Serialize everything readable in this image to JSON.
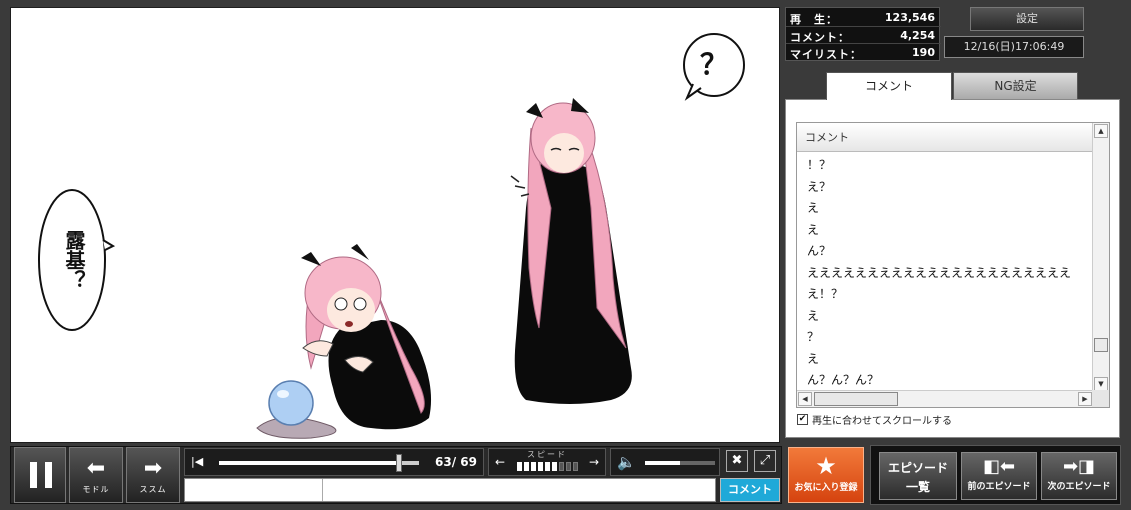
{
  "stats": {
    "play_label": "再　生：",
    "play_value": "123,546",
    "comment_label": "コメント：",
    "comment_value": "4,254",
    "mylist_label": "マイリスト：",
    "mylist_value": "190"
  },
  "settings_label": "設定",
  "datetime": "12/16(日)17:06:49",
  "tabs": {
    "comment": "コメント",
    "ng": "NG設定"
  },
  "comment_list": {
    "header": "コメント",
    "rows": [
      "！？",
      "え？",
      "え",
      "え",
      "ん？",
      "ええええええええええええええええええええええ",
      "え！？",
      "え",
      "？",
      "え",
      "ん？ん？ん？"
    ]
  },
  "autoscroll": {
    "checked": "✔",
    "label": "再生に合わせてスクロールする"
  },
  "video": {
    "bubble_right": "？",
    "bubble_left": "露基？"
  },
  "controls": {
    "back_label": "モドル",
    "forward_label": "ススム",
    "time": "63/ 69",
    "speed_label": "スピード",
    "seek_progress": 0.9,
    "volume_level": 0.5,
    "speed_level": 6,
    "speed_total": 9,
    "submit_label": "コメント"
  },
  "buttons": {
    "favorite": "お気に入り登録",
    "episode_list_1": "エピソード",
    "episode_list_2": "一覧",
    "prev_episode": "前のエピソード",
    "next_episode": "次のエピソード"
  },
  "icons": {
    "pause": "pause-icon",
    "back": "arrow-left-icon",
    "forward": "arrow-right-icon",
    "skip_start": "skip-start-icon",
    "speaker": "speaker-icon",
    "comment_off": "comment-hide-icon",
    "fullscreen": "fullscreen-icon",
    "star": "star-icon"
  }
}
